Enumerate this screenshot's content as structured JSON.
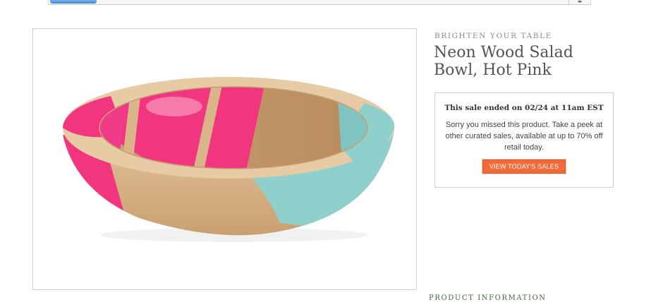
{
  "product": {
    "eyebrow": "BRIGHTEN YOUR TABLE",
    "title": "Neon Wood Salad Bowl, Hot Pink",
    "image_alt": "Neon wood salad bowl painted with hot pink and aqua stripes"
  },
  "sale": {
    "headline": "This sale ended on 02/24 at 11am EST",
    "message": "Sorry you missed this product. Take a peek at other curated sales, available at up to 70% off retail today.",
    "cta_label": "VIEW TODAY'S SALES"
  },
  "sections": {
    "product_information": "PRODUCT INFORMATION"
  },
  "colors": {
    "accent": "#f26b3a",
    "title": "#545454",
    "section_heading": "#3d6a3a",
    "pink": "#f2357f",
    "aqua": "#8fd0cc",
    "wood": "#d9b589"
  },
  "scrollbar": {
    "arrows": "◂▸"
  }
}
